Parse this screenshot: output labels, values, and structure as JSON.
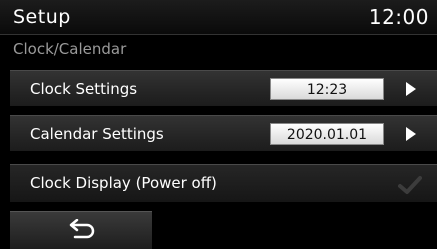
{
  "header": {
    "title": "Setup",
    "time": "12:00"
  },
  "section_title": "Clock/Calendar",
  "rows": [
    {
      "label": "Clock Settings",
      "value": "12:23",
      "icon": "chevron-right-icon"
    },
    {
      "label": "Calendar Settings",
      "value": "2020.01.01",
      "icon": "chevron-right-icon"
    },
    {
      "label": "Clock Display (Power off)",
      "checked": true,
      "icon": "checkmark-icon"
    }
  ],
  "footer": {
    "back_icon": "back-arrow-icon"
  },
  "colors": {
    "background": "#000000",
    "value_box": "#ffffff",
    "dim_text": "#9a9a9a"
  }
}
